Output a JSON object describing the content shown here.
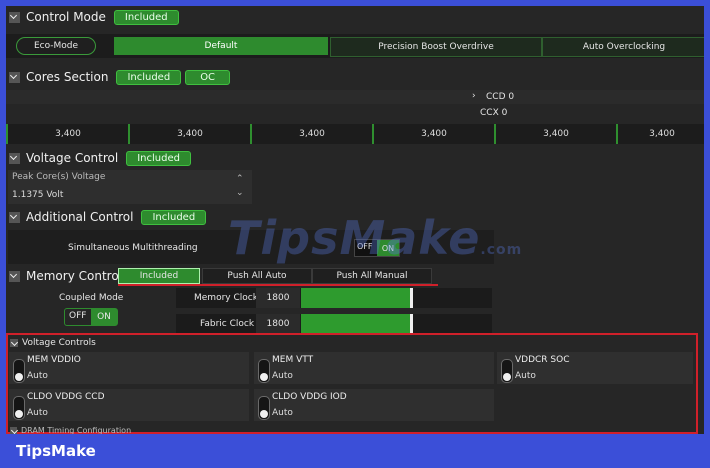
{
  "control_mode": {
    "title": "Control Mode",
    "badge": "Included",
    "options": [
      "Eco-Mode",
      "Default",
      "Precision Boost Overdrive",
      "Auto Overclocking"
    ]
  },
  "cores_section": {
    "title": "Cores Section",
    "badge": "Included",
    "oc_badge": "OC",
    "ccd": "CCD 0",
    "ccx": "CCX 0",
    "frequencies": [
      "3,400",
      "3,400",
      "3,400",
      "3,400",
      "3,400",
      "3,400"
    ]
  },
  "voltage_control": {
    "title": "Voltage Control",
    "badge": "Included",
    "peak_label": "Peak Core(s) Voltage",
    "peak_value": "1.1375 Volt"
  },
  "additional_control": {
    "title": "Additional Control",
    "badge": "Included",
    "smt_label": "Simultaneous Multithreading",
    "off": "OFF",
    "on": "ON"
  },
  "memory_control": {
    "title": "Memory Control",
    "badge": "Included",
    "push_auto": "Push All Auto",
    "push_manual": "Push All Manual",
    "coupled_label": "Coupled Mode",
    "coupled_off": "OFF",
    "coupled_on": "ON",
    "memory_clock_label": "Memory Clock",
    "memory_clock_value": "1800",
    "memory_clock_fill": 0.6,
    "fabric_clock_label": "Fabric Clock",
    "fabric_clock_value": "1800",
    "fabric_clock_fill": 0.6
  },
  "voltage_controls": {
    "title": "Voltage Controls",
    "items": [
      {
        "name": "MEM VDDIO",
        "value": "Auto"
      },
      {
        "name": "MEM VTT",
        "value": "Auto"
      },
      {
        "name": "VDDCR SOC",
        "value": "Auto"
      },
      {
        "name": "CLDO VDDG CCD",
        "value": "Auto"
      },
      {
        "name": "CLDO VDDG IOD",
        "value": "Auto"
      }
    ],
    "next_section": "DRAM Timing Configuration"
  },
  "watermark": "TipsMake",
  "watermark_suffix": ".com",
  "footer": "TipsMake",
  "colors": {
    "accent_green": "#2e8b2e",
    "highlight_red": "#d0202a",
    "frame_blue": "#3b4fd8"
  }
}
